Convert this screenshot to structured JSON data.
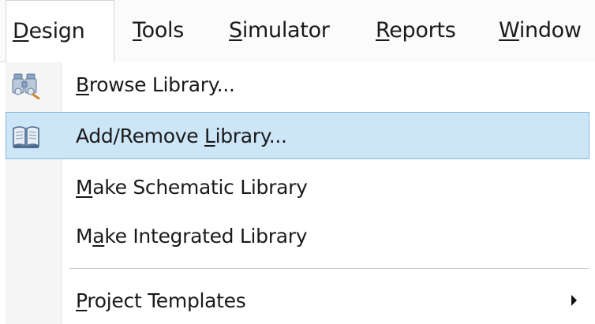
{
  "menubar": {
    "items": [
      {
        "accel": "D",
        "rest": "esign"
      },
      {
        "accel": "T",
        "rest": "ools"
      },
      {
        "accel": "S",
        "rest": "imulator"
      },
      {
        "accel": "R",
        "rest": "eports"
      },
      {
        "accel": "W",
        "rest": "indow"
      }
    ]
  },
  "dropdown": {
    "items": [
      {
        "pre": "",
        "accel": "B",
        "post": "rowse Library...",
        "icon": "binoculars-icon"
      },
      {
        "pre": "Add/Remove ",
        "accel": "L",
        "post": "ibrary...",
        "icon": "book-icon",
        "highlighted": true
      },
      {
        "pre": "",
        "accel": "M",
        "post": "ake Schematic Library"
      },
      {
        "pre": "M",
        "accel": "a",
        "post": "ke Integrated Library"
      },
      {
        "pre": "",
        "accel": "P",
        "post": "roject Templates",
        "has_submenu": true
      }
    ]
  },
  "colors": {
    "highlight_bg": "#cde6f7",
    "highlight_border": "#86b9e0"
  }
}
